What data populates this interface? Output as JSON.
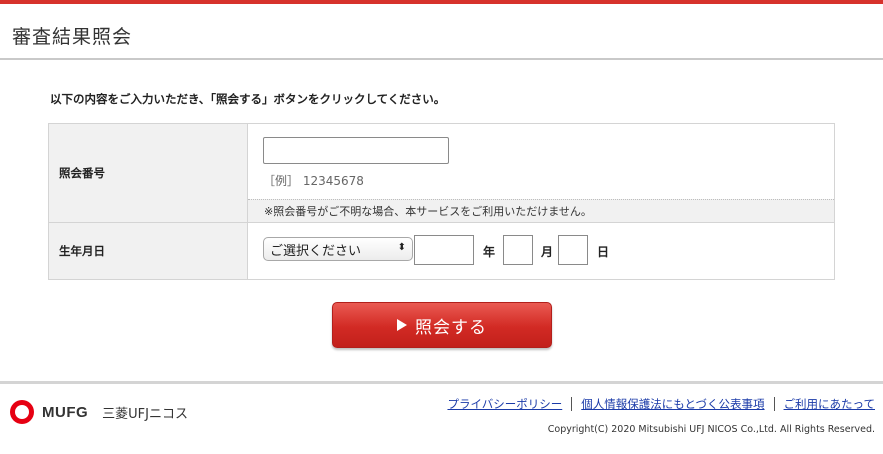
{
  "header": {
    "title": "審査結果照会"
  },
  "instruction": "以下の内容をご入力いただき、「照会する」ボタンをクリックしてください。",
  "form": {
    "inquiry_number": {
      "label": "照会番号",
      "value": "",
      "example": "［例］ 12345678",
      "note": "※照会番号がご不明な場合、本サービスをご利用いただけません。"
    },
    "birthdate": {
      "label": "生年月日",
      "era_select": {
        "selected": "ご選択ください",
        "arrow": "⬍"
      },
      "year_value": "",
      "year_unit": "年",
      "month_value": "",
      "month_unit": "月",
      "day_value": "",
      "day_unit": "日"
    }
  },
  "submit": {
    "label": "照会する",
    "icon": "play-icon"
  },
  "footer": {
    "logo": {
      "mark": "mufg-logo-icon",
      "text": "MUFG",
      "sub": "三菱UFJニコス"
    },
    "links": [
      "プライバシーポリシー",
      "個人情報保護法にもとづく公表事項",
      "ご利用にあたって"
    ],
    "copyright": "Copyright(C) 2020 Mitsubishi UFJ NICOS Co.,Ltd. All Rights Reserved."
  },
  "colors": {
    "accent": "#d7322c",
    "link": "#1a3aa8",
    "label_bg": "#f1f1f1"
  }
}
